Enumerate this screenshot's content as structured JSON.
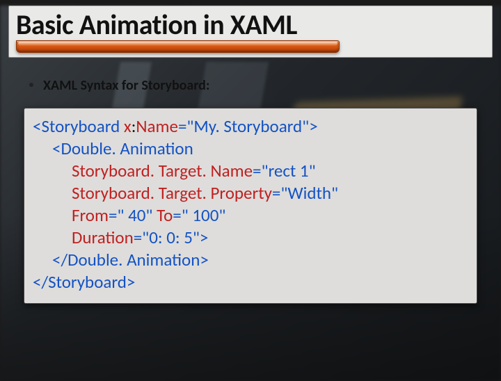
{
  "title": "Basic Animation in XAML",
  "bullet_text": "XAML Syntax for Storyboard:",
  "code": {
    "l1_open": "<Storyboard",
    "l1_attr": " x",
    "l1_colon": ":",
    "l1_name": "Name",
    "l1_eq": "=\"My. Storyboard\">",
    "l2": "<Double. Animation",
    "l3_attr": "Storyboard. Target. Name",
    "l3_eq": "=\"rect 1\"",
    "l4_attr": "Storyboard. Target. Property",
    "l4_eq": "=\"Width\"",
    "l5_from": "From",
    "l5_from_eq": "=\" 40\"",
    "l5_to": " To",
    "l5_to_eq": "=\" 100\"",
    "l6_attr": "Duration",
    "l6_eq": "=\"0: 0: 5\">",
    "l7": "</Double. Animation>",
    "l8": "</Storyboard>"
  }
}
